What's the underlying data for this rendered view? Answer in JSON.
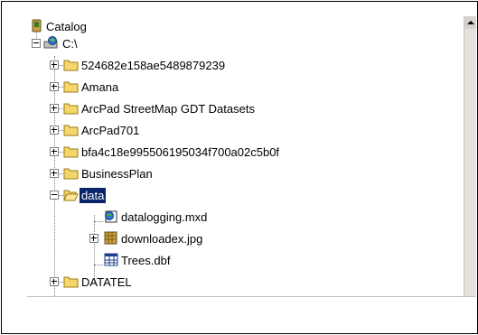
{
  "tree": {
    "root": {
      "label": "Catalog",
      "icon": "catalog-icon"
    },
    "drive": {
      "label": "C:\\",
      "icon": "drive-icon"
    },
    "folders": [
      {
        "label": "524682e158ae5489879239",
        "icon": "folder-icon"
      },
      {
        "label": "Amana",
        "icon": "folder-icon"
      },
      {
        "label": "ArcPad StreetMap GDT Datasets",
        "icon": "folder-icon"
      },
      {
        "label": "ArcPad701",
        "icon": "folder-icon"
      },
      {
        "label": "bfa4c18e995506195034f700a02c5b0f",
        "icon": "folder-icon"
      },
      {
        "label": "BusinessPlan",
        "icon": "folder-icon"
      },
      {
        "label": "data",
        "icon": "folder-open-icon",
        "selected": true
      },
      {
        "label": "DATATEL",
        "icon": "folder-icon"
      }
    ],
    "data_children": [
      {
        "label": "datalogging.mxd",
        "icon": "map-document-icon"
      },
      {
        "label": "downloadex.jpg",
        "icon": "raster-image-icon"
      },
      {
        "label": "Trees.dbf",
        "icon": "table-icon"
      }
    ]
  },
  "colors": {
    "selection": "#0a246a",
    "folder": "#f5d66b",
    "folder_edge": "#9c7b14"
  }
}
